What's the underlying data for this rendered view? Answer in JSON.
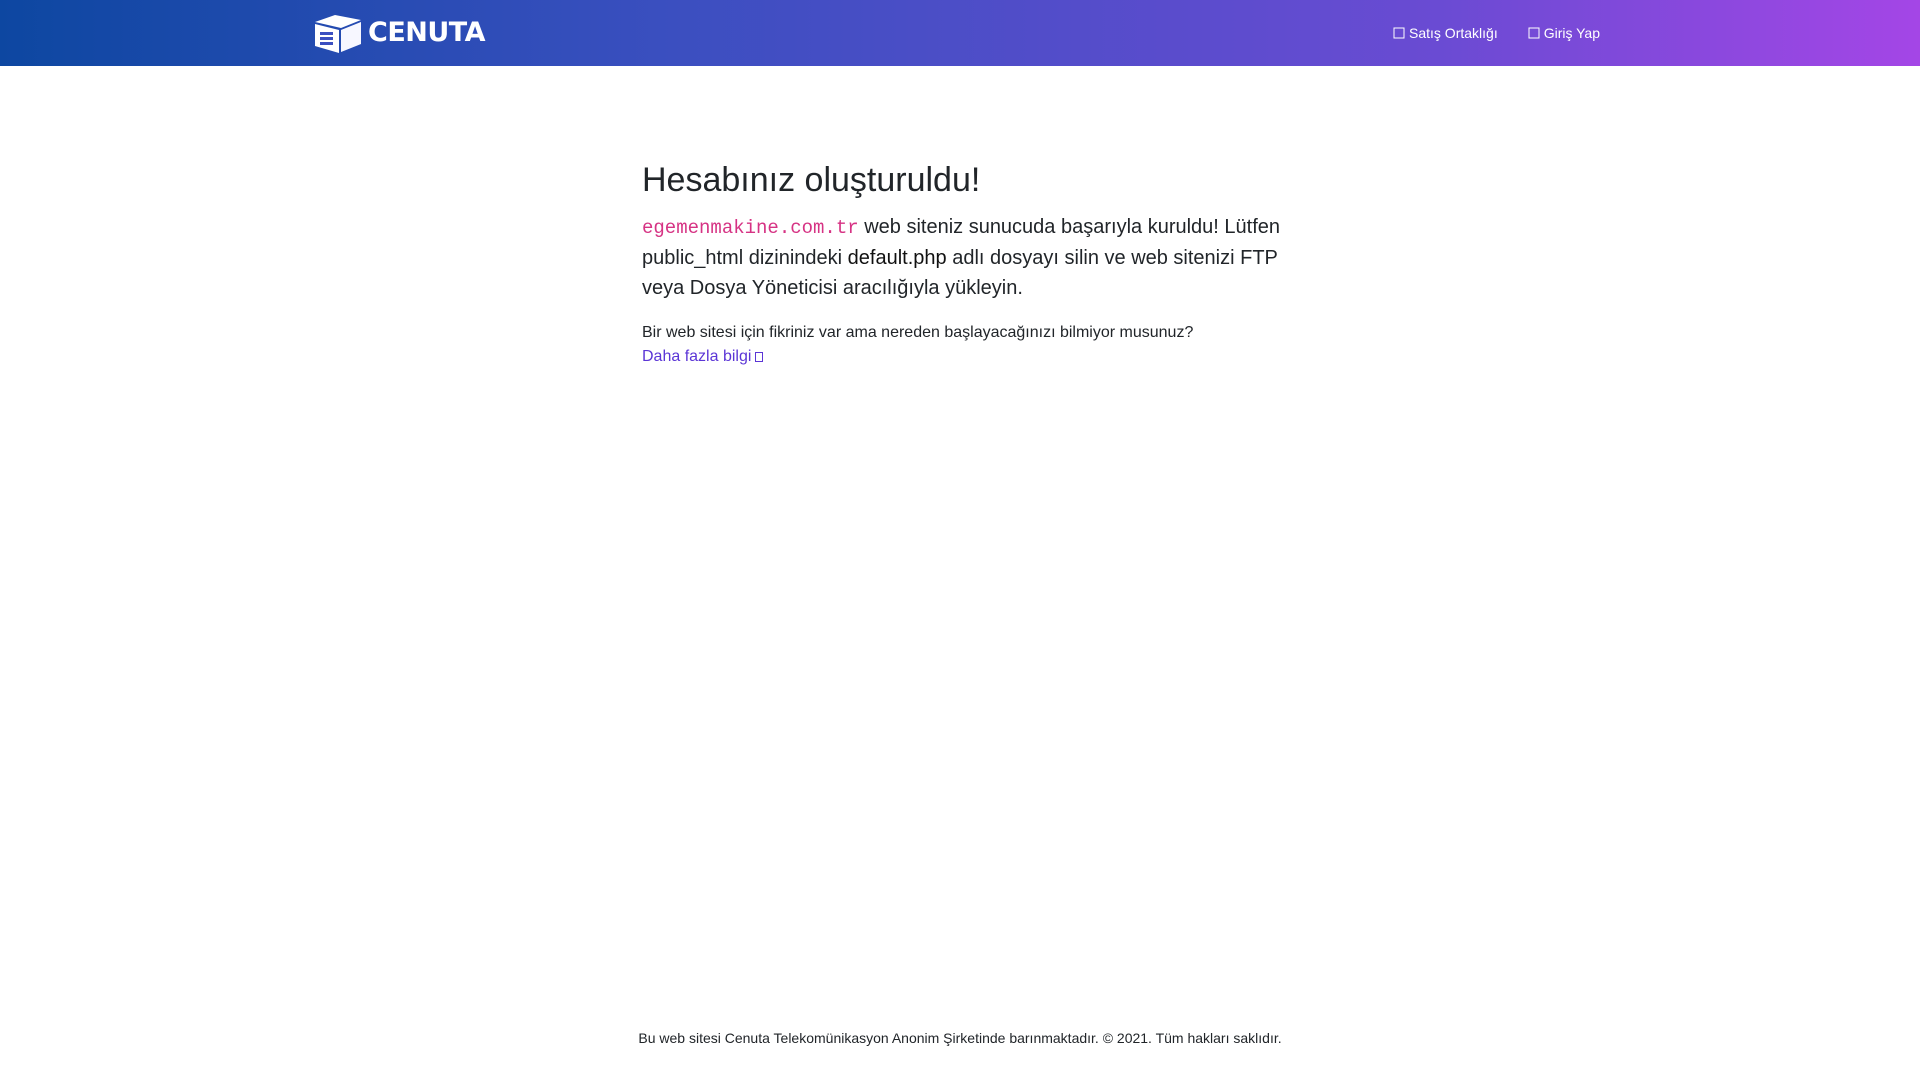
{
  "header": {
    "brand_name": "CENUTA",
    "logo_icon": "cenuta-box-logo-icon",
    "nav": [
      {
        "label": "Satış Ortaklığı",
        "icon": "handshake-icon"
      },
      {
        "label": "Giriş Yap",
        "icon": "login-icon"
      }
    ],
    "gradient": [
      "#0d47a1",
      "#3b4fc0",
      "#6a4bd3",
      "#a446e6"
    ]
  },
  "main": {
    "title": "Hesabınız oluşturuldu!",
    "domain": "egemenmakine.com.tr",
    "lead_after_domain": " web siteniz sunucuda başarıyla kuruldu! Lütfen public_html dizinindeki ",
    "file_name": "default.php",
    "lead_end": " adlı dosyayı silin ve web sitenizi FTP veya Dosya Yöneticisi aracılığıyla yükleyin.",
    "question": "Bir web sitesi için fikriniz var ama nereden başlayacağınızı bilmiyor musunuz?",
    "learn_more": "Daha fazla bilgi",
    "learn_more_icon": "external-link-icon",
    "link_color": "#5b35d6",
    "code_color": "#d63384"
  },
  "footer": {
    "text": "Bu web sitesi Cenuta Telekomünikasyon Anonim Şirketinde barınmaktadır. © 2021. Tüm hakları saklıdır."
  }
}
